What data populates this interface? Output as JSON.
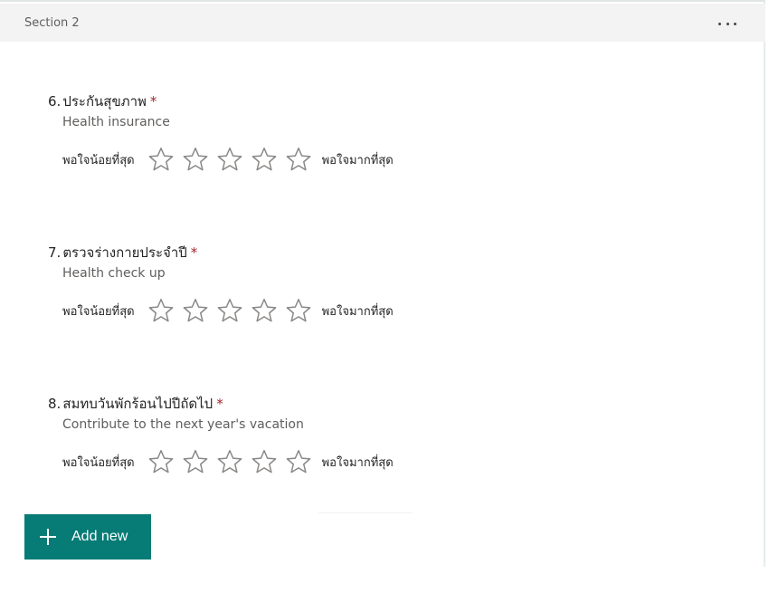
{
  "section": {
    "title": "Section 2"
  },
  "questions": [
    {
      "number": "6.",
      "title": "ประกันสุขภาพ",
      "required_mark": "*",
      "subtitle": "Health insurance",
      "rating": {
        "min_label": "พอใจน้อยที่สุด",
        "max_label": "พอใจมากที่สุด",
        "star_count": 5,
        "selected": 0
      }
    },
    {
      "number": "7.",
      "title": "ตรวจร่างกายประจำปี",
      "required_mark": "*",
      "subtitle": "Health check up",
      "rating": {
        "min_label": "พอใจน้อยที่สุด",
        "max_label": "พอใจมากที่สุด",
        "star_count": 5,
        "selected": 0
      }
    },
    {
      "number": "8.",
      "title": "สมทบวันพักร้อนไปปีถัดไป",
      "required_mark": "*",
      "subtitle": "Contribute to the next year's vacation",
      "rating": {
        "min_label": "พอใจน้อยที่สุด",
        "max_label": "พอใจมากที่สุด",
        "star_count": 5,
        "selected": 0
      }
    }
  ],
  "add_new": {
    "label": "Add new",
    "icon": "plus-icon"
  },
  "colors": {
    "accent": "#077b75",
    "required": "#a4262c",
    "star_outline": "#8a8886",
    "header_bg": "#f3f3f3"
  }
}
